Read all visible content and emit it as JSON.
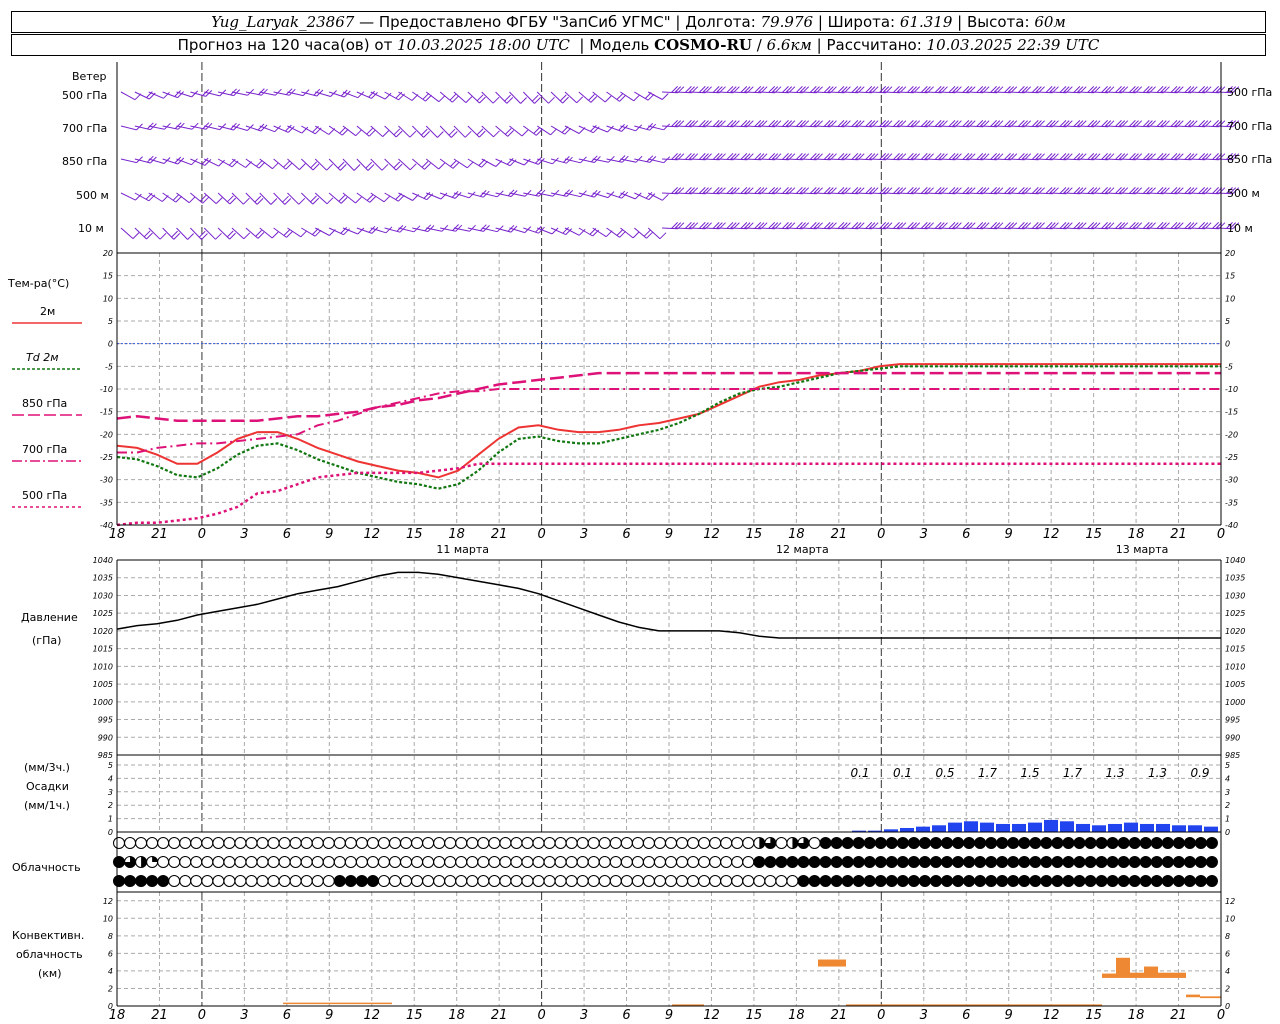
{
  "header": {
    "station": "Yug_Laryak_23867",
    "provider_text": "Предоставлено ФГБУ \"ЗапСиб УГМС\"",
    "lon_label": "Долгота:",
    "lon": "79.976",
    "lat_label": "Широта:",
    "lat": "61.319",
    "alt_label": "Высота:",
    "alt": "60м",
    "forecast_label": "Прогноз на 120 часа(ов) от",
    "forecast_start": "10.03.2025 18:00 UTC",
    "model_label": "Модель",
    "model": "COSMO-RU",
    "resolution": "6.6км",
    "calc_label": "Рассчитано:",
    "calc_time": "10.03.2025 22:39 UTC"
  },
  "panels": {
    "wind": {
      "title": "Ветер",
      "levels": [
        "500 гПа",
        "700 гПа",
        "850 гПа",
        "500 м",
        "10 м"
      ]
    },
    "temp": {
      "title": "Тем-ра(°С)",
      "legend": [
        {
          "label": "2м",
          "color": "#ee3333"
        },
        {
          "label": "Td 2м",
          "color": "#117711"
        },
        {
          "label": "850 гПа",
          "color": "#dd1177"
        },
        {
          "label": "700 гПа",
          "color": "#dd1177"
        },
        {
          "label": "500 гПа",
          "color": "#dd1177"
        }
      ]
    },
    "pressure": {
      "title": "Давление",
      "units": "(гПа)"
    },
    "precip": {
      "units_top": "(мм/3ч.)",
      "title": "Осадки",
      "units_bottom": "(мм/1ч.)"
    },
    "cloud": {
      "title": "Облачность"
    },
    "conv": {
      "title_1": "Конвективн.",
      "title_2": "облачность",
      "units": "(км)"
    }
  },
  "x_tick_labels": [
    "18",
    "21",
    "0",
    "3",
    "6",
    "9",
    "12",
    "15",
    "18",
    "21",
    "0",
    "3",
    "6",
    "9",
    "12",
    "15",
    "18",
    "21",
    "0",
    "3",
    "6",
    "9",
    "12",
    "15",
    "18",
    "21",
    "0"
  ],
  "day_labels": [
    "11 марта",
    "12 марта",
    "13 марта"
  ],
  "chart_data": [
    {
      "type": "line",
      "title": "Тем-ра(°С)",
      "x_hours": [
        0,
        6,
        12,
        18,
        24,
        30,
        36,
        42,
        48,
        54,
        60,
        66,
        72,
        78,
        84,
        90,
        96,
        102,
        108,
        114,
        120,
        126,
        132,
        138,
        144,
        150,
        156,
        162,
        168,
        174,
        180,
        186,
        192,
        198,
        204,
        210,
        216,
        222,
        228,
        234,
        240,
        246,
        252,
        258,
        264,
        270,
        276,
        282,
        288,
        294,
        300,
        306,
        312,
        318,
        324,
        330
      ],
      "ylim": [
        -40,
        20
      ],
      "yticks": [
        20,
        15,
        10,
        5,
        0,
        -5,
        -10,
        -15,
        -20,
        -25,
        -30,
        -35,
        -40
      ],
      "series": [
        {
          "name": "2м",
          "values": [
            -22.5,
            -23,
            -24.5,
            -26.5,
            -26.5,
            -24,
            -21,
            -19.5,
            -19.5,
            -21,
            -23,
            -24.5,
            -26,
            -27,
            -28,
            -28.5,
            -29.5,
            -28,
            -24.5,
            -21,
            -18.5,
            -18,
            -19,
            -19.5,
            -19.5,
            -19,
            -18,
            -17.5,
            -16.5,
            -15.5,
            -13.5,
            -11.5,
            -9.5,
            -8.5,
            -8,
            -7,
            -6.5,
            -6,
            -5,
            -4.5,
            -4.5,
            -4.5,
            -4.5,
            -4.5,
            -4.5,
            -4.5,
            -4.5,
            -4.5,
            -4.5,
            -4.5,
            -4.5,
            -4.5,
            -4.5,
            -4.5,
            -4.5,
            -4.5
          ]
        },
        {
          "name": "Td 2м",
          "values": [
            -25,
            -25.5,
            -27,
            -29,
            -29.5,
            -27.5,
            -24.5,
            -22.5,
            -22,
            -23.5,
            -25.5,
            -27,
            -28.5,
            -29.5,
            -30.5,
            -31,
            -32,
            -31,
            -28,
            -24,
            -21,
            -20.5,
            -21.5,
            -22,
            -22,
            -21,
            -20,
            -19,
            -17.5,
            -15.5,
            -13,
            -11,
            -10,
            -9.5,
            -8.5,
            -7.5,
            -6.5,
            -6,
            -5.5,
            -5,
            -5,
            -5,
            -5,
            -5,
            -5,
            -5,
            -5,
            -5,
            -5,
            -5,
            -5,
            -5,
            -5,
            -5,
            -5,
            -5
          ]
        },
        {
          "name": "850 гПа",
          "values": [
            -16.5,
            -16,
            -16.5,
            -17,
            -17,
            -17,
            -17,
            -17,
            -16.5,
            -16,
            -16,
            -15.5,
            -15,
            -14,
            -13.5,
            -12.5,
            -12,
            -11,
            -10,
            -9,
            -8.5,
            -8,
            -7.5,
            -7,
            -6.5,
            -6.5,
            -6.5,
            -6.5,
            -6.5,
            -6.5,
            -6.5,
            -6.5,
            -6.5,
            -6.5,
            -6.5,
            -6.5,
            -6.5,
            -6.5,
            -6.5,
            -6.5,
            -6.5,
            -6.5,
            -6.5,
            -6.5,
            -6.5,
            -6.5,
            -6.5,
            -6.5,
            -6.5,
            -6.5,
            -6.5,
            -6.5,
            -6.5,
            -6.5,
            -6.5,
            -6.5
          ]
        },
        {
          "name": "700 гПа",
          "values": [
            -24,
            -24,
            -23,
            -22.5,
            -22,
            -22,
            -21.5,
            -21,
            -20.5,
            -20,
            -18,
            -17,
            -15.5,
            -14,
            -13,
            -12,
            -11,
            -10.5,
            -10.5,
            -10,
            -10,
            -10,
            -10,
            -10,
            -10,
            -10,
            -10,
            -10,
            -10,
            -10,
            -10,
            -10,
            -10,
            -10,
            -10,
            -10,
            -10,
            -10,
            -10,
            -10,
            -10,
            -10,
            -10,
            -10,
            -10,
            -10,
            -10,
            -10,
            -10,
            -10,
            -10,
            -10,
            -10,
            -10,
            -10,
            -10
          ]
        },
        {
          "name": "500 гПа",
          "values": [
            -40,
            -39.5,
            -39.5,
            -39,
            -38.5,
            -37.5,
            -36,
            -33,
            -32.5,
            -31,
            -29.5,
            -29,
            -28.5,
            -28.5,
            -28.5,
            -28.5,
            -28,
            -27.5,
            -26.5,
            -26.5,
            -26.5,
            -26.5,
            -26.5,
            -26.5,
            -26.5,
            -26.5,
            -26.5,
            -26.5,
            -26.5,
            -26.5,
            -26.5,
            -26.5,
            -26.5,
            -26.5,
            -26.5,
            -26.5,
            -26.5,
            -26.5,
            -26.5,
            -26.5,
            -26.5,
            -26.5,
            -26.5,
            -26.5,
            -26.5,
            -26.5,
            -26.5,
            -26.5,
            -26.5,
            -26.5,
            -26.5,
            -26.5,
            -26.5,
            -26.5,
            -26.5,
            -26.5
          ]
        }
      ]
    },
    {
      "type": "line",
      "title": "Давление",
      "ylabel": "(гПа)",
      "ylim": [
        985,
        1040
      ],
      "yticks": [
        1040,
        1035,
        1030,
        1025,
        1020,
        1015,
        1010,
        1005,
        1000,
        995,
        990,
        985
      ],
      "series": [
        {
          "name": "Давление",
          "values": [
            1020.5,
            1021.5,
            1022,
            1023,
            1024.5,
            1025.5,
            1026.5,
            1027.5,
            1029,
            1030.5,
            1031.5,
            1032.5,
            1034,
            1035.5,
            1036.5,
            1036.5,
            1036,
            1035,
            1034,
            1033,
            1032,
            1030.5,
            1028.5,
            1026.5,
            1024.5,
            1022.5,
            1021,
            1020,
            1020,
            1020,
            1020,
            1019.5,
            1018.5,
            1018,
            1018,
            1018,
            1018,
            1018,
            1018,
            1018,
            1018,
            1018,
            1018,
            1018,
            1018,
            1018,
            1018,
            1018,
            1018,
            1018,
            1018,
            1018,
            1018,
            1018,
            1018,
            1018
          ]
        }
      ]
    },
    {
      "type": "bar",
      "title": "Осадки",
      "ylabel": "(мм/1ч.)",
      "ylim": [
        0,
        5
      ],
      "yticks": [
        5,
        4,
        3,
        2,
        1,
        0
      ],
      "labels_3h": [
        "0.1",
        "0.1",
        "0.5",
        "1.7",
        "1.5",
        "1.7",
        "1.3",
        "1.3",
        "0.9"
      ],
      "hourly_values": [
        0.1,
        0.1,
        0.2,
        0.3,
        0.4,
        0.5,
        0.7,
        0.8,
        0.7,
        0.6,
        0.6,
        0.7,
        0.9,
        0.8,
        0.6,
        0.5,
        0.6,
        0.7,
        0.6,
        0.6,
        0.5,
        0.5,
        0.4
      ]
    },
    {
      "type": "bar",
      "title": "Конвективн. облачность",
      "ylabel": "(км)",
      "ylim": [
        0,
        13
      ],
      "yticks": [
        12,
        10,
        8,
        6,
        4,
        2,
        0
      ]
    }
  ]
}
